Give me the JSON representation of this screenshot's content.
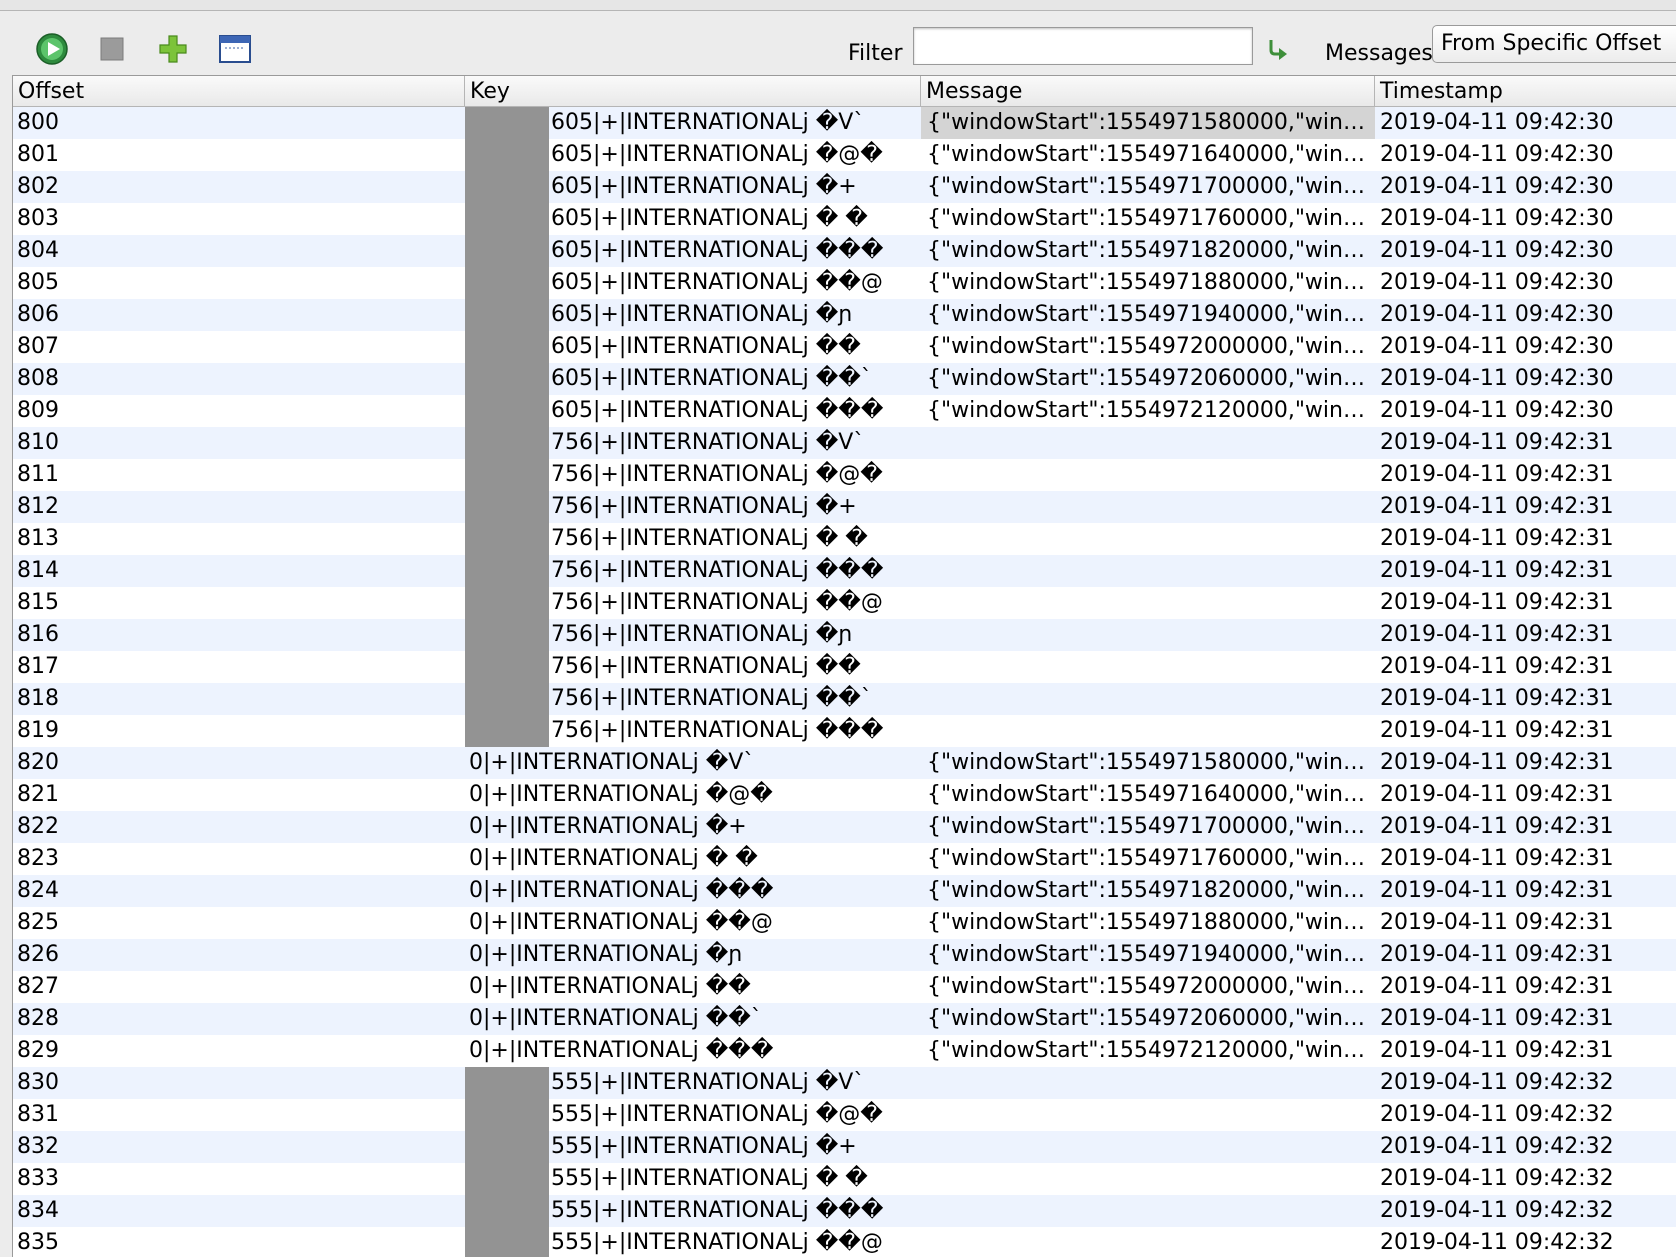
{
  "toolbar": {
    "filter_label": "Filter",
    "filter_value": "",
    "messages_label": "Messages",
    "messages_mode": "From Specific Offset",
    "icons": [
      "play-icon",
      "stop-icon",
      "add-icon",
      "window-icon",
      "apply-filter-icon"
    ]
  },
  "table": {
    "columns": [
      "Offset",
      "Key",
      "Message",
      "Timestamp"
    ],
    "rows": [
      {
        "offset": "800",
        "key": "605|+|INTERNATIONALj �V`",
        "message": "{\"windowStart\":1554971580000,\"windo...",
        "timestamp": "2019-04-11 09:42:30",
        "redacted": true
      },
      {
        "offset": "801",
        "key": "605|+|INTERNATIONALj �@�",
        "message": "{\"windowStart\":1554971640000,\"windo...",
        "timestamp": "2019-04-11 09:42:30",
        "redacted": true
      },
      {
        "offset": "802",
        "key": "605|+|INTERNATIONALj �+",
        "message": "{\"windowStart\":1554971700000,\"windo...",
        "timestamp": "2019-04-11 09:42:30",
        "redacted": true
      },
      {
        "offset": "803",
        "key": "605|+|INTERNATIONALj � �",
        "message": "{\"windowStart\":1554971760000,\"windo...",
        "timestamp": "2019-04-11 09:42:30",
        "redacted": true
      },
      {
        "offset": "804",
        "key": "605|+|INTERNATIONALj ���",
        "message": "{\"windowStart\":1554971820000,\"windo...",
        "timestamp": "2019-04-11 09:42:30",
        "redacted": true
      },
      {
        "offset": "805",
        "key": "605|+|INTERNATIONALj ��@",
        "message": "{\"windowStart\":1554971880000,\"windo...",
        "timestamp": "2019-04-11 09:42:30",
        "redacted": true
      },
      {
        "offset": "806",
        "key": "605|+|INTERNATIONALj �ɲ",
        "message": "{\"windowStart\":1554971940000,\"windo...",
        "timestamp": "2019-04-11 09:42:30",
        "redacted": true
      },
      {
        "offset": "807",
        "key": "605|+|INTERNATIONALj ��",
        "message": "{\"windowStart\":1554972000000,\"windo...",
        "timestamp": "2019-04-11 09:42:30",
        "redacted": true
      },
      {
        "offset": "808",
        "key": "605|+|INTERNATIONALj ��`",
        "message": "{\"windowStart\":1554972060000,\"windo...",
        "timestamp": "2019-04-11 09:42:30",
        "redacted": true
      },
      {
        "offset": "809",
        "key": "605|+|INTERNATIONALj ���",
        "message": "{\"windowStart\":1554972120000,\"windo...",
        "timestamp": "2019-04-11 09:42:30",
        "redacted": true
      },
      {
        "offset": "810",
        "key": "756|+|INTERNATIONALj �V`",
        "message": "",
        "timestamp": "2019-04-11 09:42:31",
        "redacted": true
      },
      {
        "offset": "811",
        "key": "756|+|INTERNATIONALj �@�",
        "message": "",
        "timestamp": "2019-04-11 09:42:31",
        "redacted": true
      },
      {
        "offset": "812",
        "key": "756|+|INTERNATIONALj �+",
        "message": "",
        "timestamp": "2019-04-11 09:42:31",
        "redacted": true
      },
      {
        "offset": "813",
        "key": "756|+|INTERNATIONALj � �",
        "message": "",
        "timestamp": "2019-04-11 09:42:31",
        "redacted": true
      },
      {
        "offset": "814",
        "key": "756|+|INTERNATIONALj ���",
        "message": "",
        "timestamp": "2019-04-11 09:42:31",
        "redacted": true
      },
      {
        "offset": "815",
        "key": "756|+|INTERNATIONALj ��@",
        "message": "",
        "timestamp": "2019-04-11 09:42:31",
        "redacted": true
      },
      {
        "offset": "816",
        "key": "756|+|INTERNATIONALj �ɲ",
        "message": "",
        "timestamp": "2019-04-11 09:42:31",
        "redacted": true
      },
      {
        "offset": "817",
        "key": "756|+|INTERNATIONALj ��",
        "message": "",
        "timestamp": "2019-04-11 09:42:31",
        "redacted": true
      },
      {
        "offset": "818",
        "key": "756|+|INTERNATIONALj ��`",
        "message": "",
        "timestamp": "2019-04-11 09:42:31",
        "redacted": true
      },
      {
        "offset": "819",
        "key": "756|+|INTERNATIONALj ���",
        "message": "",
        "timestamp": "2019-04-11 09:42:31",
        "redacted": true
      },
      {
        "offset": "820",
        "key": "0|+|INTERNATIONALj �V`",
        "message": "{\"windowStart\":1554971580000,\"windo...",
        "timestamp": "2019-04-11 09:42:31",
        "redacted": false
      },
      {
        "offset": "821",
        "key": "0|+|INTERNATIONALj �@�",
        "message": "{\"windowStart\":1554971640000,\"windo...",
        "timestamp": "2019-04-11 09:42:31",
        "redacted": false
      },
      {
        "offset": "822",
        "key": "0|+|INTERNATIONALj �+",
        "message": "{\"windowStart\":1554971700000,\"windo...",
        "timestamp": "2019-04-11 09:42:31",
        "redacted": false
      },
      {
        "offset": "823",
        "key": "0|+|INTERNATIONALj � �",
        "message": "{\"windowStart\":1554971760000,\"windo...",
        "timestamp": "2019-04-11 09:42:31",
        "redacted": false
      },
      {
        "offset": "824",
        "key": "0|+|INTERNATIONALj ���",
        "message": "{\"windowStart\":1554971820000,\"windo...",
        "timestamp": "2019-04-11 09:42:31",
        "redacted": false
      },
      {
        "offset": "825",
        "key": "0|+|INTERNATIONALj ��@",
        "message": "{\"windowStart\":1554971880000,\"windo...",
        "timestamp": "2019-04-11 09:42:31",
        "redacted": false
      },
      {
        "offset": "826",
        "key": "0|+|INTERNATIONALj �ɲ",
        "message": "{\"windowStart\":1554971940000,\"windo...",
        "timestamp": "2019-04-11 09:42:31",
        "redacted": false
      },
      {
        "offset": "827",
        "key": "0|+|INTERNATIONALj ��",
        "message": "{\"windowStart\":1554972000000,\"windo...",
        "timestamp": "2019-04-11 09:42:31",
        "redacted": false
      },
      {
        "offset": "828",
        "key": "0|+|INTERNATIONALj ��`",
        "message": "{\"windowStart\":1554972060000,\"windo...",
        "timestamp": "2019-04-11 09:42:31",
        "redacted": false
      },
      {
        "offset": "829",
        "key": "0|+|INTERNATIONALj ���",
        "message": "{\"windowStart\":1554972120000,\"windo...",
        "timestamp": "2019-04-11 09:42:31",
        "redacted": false
      },
      {
        "offset": "830",
        "key": "555|+|INTERNATIONALj �V`",
        "message": "",
        "timestamp": "2019-04-11 09:42:32",
        "redacted": true
      },
      {
        "offset": "831",
        "key": "555|+|INTERNATIONALj �@�",
        "message": "",
        "timestamp": "2019-04-11 09:42:32",
        "redacted": true
      },
      {
        "offset": "832",
        "key": "555|+|INTERNATIONALj �+",
        "message": "",
        "timestamp": "2019-04-11 09:42:32",
        "redacted": true
      },
      {
        "offset": "833",
        "key": "555|+|INTERNATIONALj � �",
        "message": "",
        "timestamp": "2019-04-11 09:42:32",
        "redacted": true
      },
      {
        "offset": "834",
        "key": "555|+|INTERNATIONALj ���",
        "message": "",
        "timestamp": "2019-04-11 09:42:32",
        "redacted": true
      },
      {
        "offset": "835",
        "key": "555|+|INTERNATIONALj ��@",
        "message": "",
        "timestamp": "2019-04-11 09:42:32",
        "redacted": true
      }
    ]
  }
}
